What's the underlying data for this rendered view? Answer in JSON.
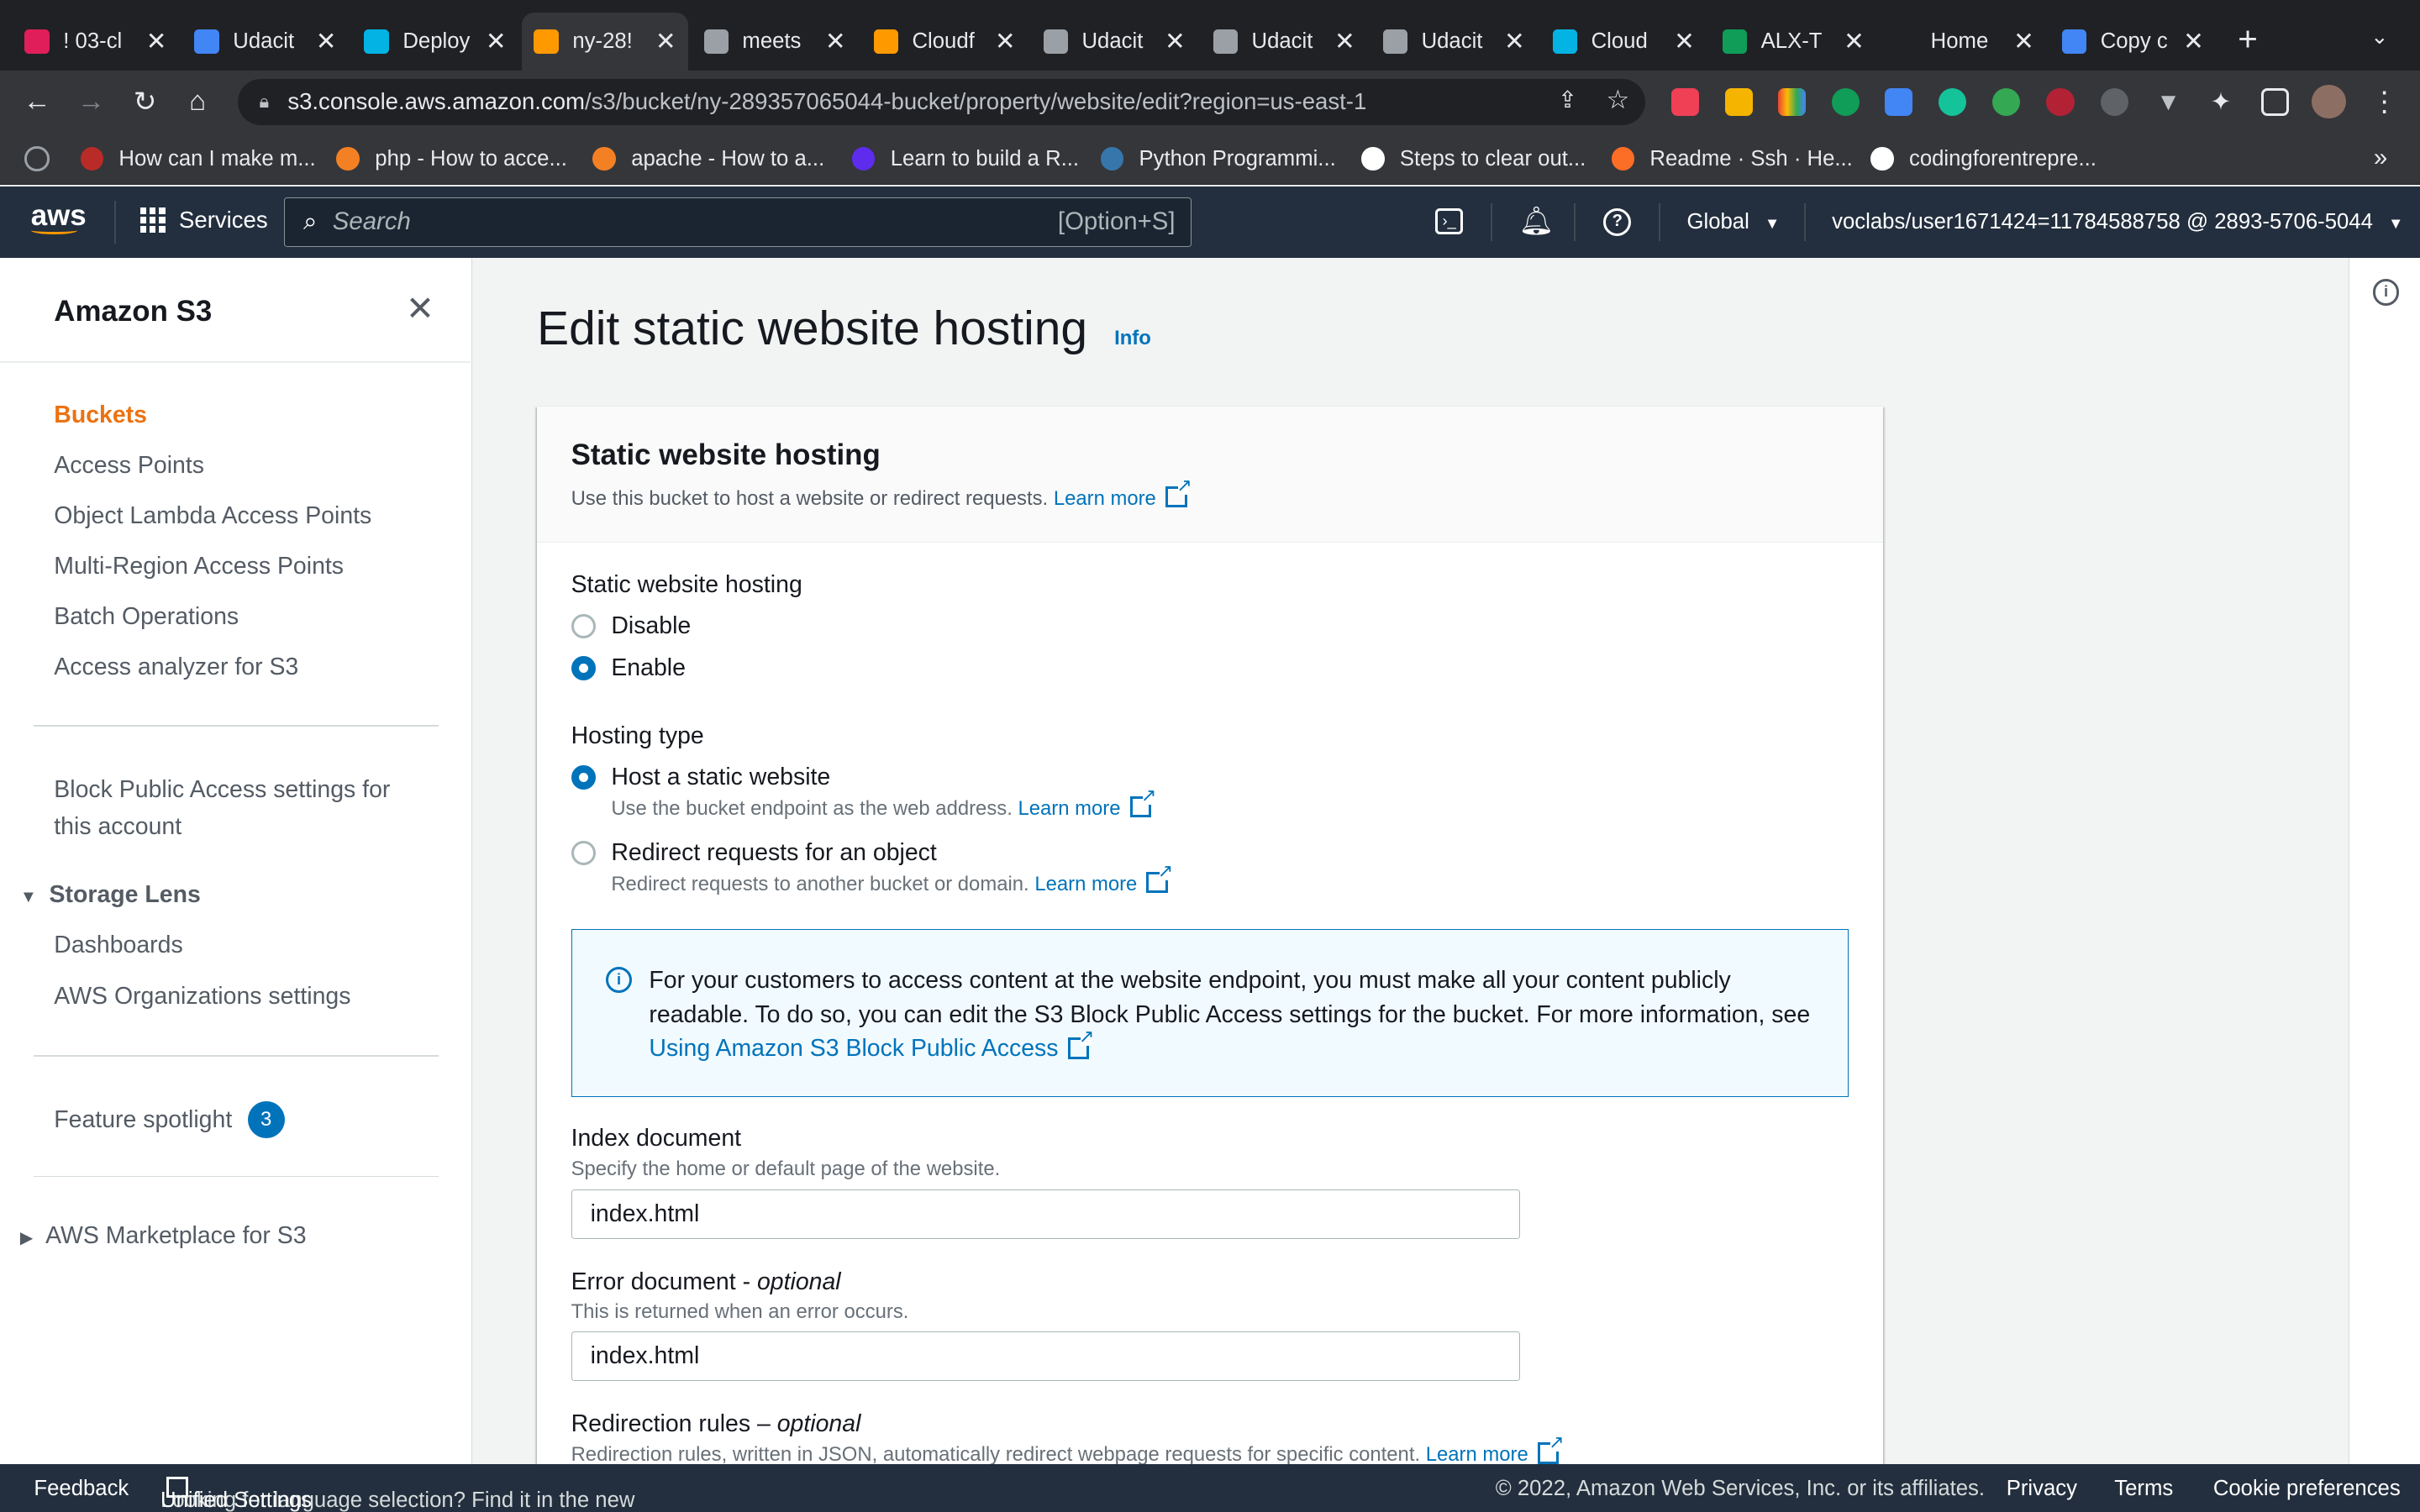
{
  "browser": {
    "tabs": [
      {
        "title": "! 03-cl",
        "favicon_color": "#e01e5a",
        "active": false
      },
      {
        "title": "Udacit",
        "favicon_color": "#4285f4",
        "active": false
      },
      {
        "title": "Deploy",
        "favicon_color": "#02b3e4",
        "active": false
      },
      {
        "title": "ny-28!",
        "favicon_color": "#f90",
        "active": true
      },
      {
        "title": "meets",
        "favicon_color": "#9aa0a6",
        "active": false
      },
      {
        "title": "Cloudf",
        "favicon_color": "#f90",
        "active": false
      },
      {
        "title": "Udacit",
        "favicon_color": "#9aa0a6",
        "active": false
      },
      {
        "title": "Udacit",
        "favicon_color": "#9aa0a6",
        "active": false
      },
      {
        "title": "Udacit",
        "favicon_color": "#9aa0a6",
        "active": false
      },
      {
        "title": "Cloud",
        "favicon_color": "#02b3e4",
        "active": false
      },
      {
        "title": "ALX-T",
        "favicon_color": "#0f9d58",
        "active": false
      },
      {
        "title": "Home",
        "favicon_color": "#202124",
        "active": false
      },
      {
        "title": "Copy c",
        "favicon_color": "#4285f4",
        "active": false
      }
    ],
    "url_host": "s3.console.aws.amazon.com",
    "url_path": "/s3/bucket/ny-289357065044-bucket/property/website/edit?region=us-east-1",
    "bookmarks": [
      {
        "label": "How can I make m...",
        "color": "#b92b27"
      },
      {
        "label": "php - How to acce...",
        "color": "#f48024"
      },
      {
        "label": "apache - How to a...",
        "color": "#f48024"
      },
      {
        "label": "Learn to build a R...",
        "color": "#5e2ced"
      },
      {
        "label": "Python Programmi...",
        "color": "#3776ab"
      },
      {
        "label": "Steps to clear out...",
        "color": "#ffffff"
      },
      {
        "label": "Readme · Ssh · He...",
        "color": "#fc6d26"
      },
      {
        "label": "codingforentrepre...",
        "color": "#ffffff"
      }
    ]
  },
  "aws_header": {
    "logo": "aws",
    "services_label": "Services",
    "search_placeholder": "Search",
    "search_shortcut": "[Option+S]",
    "region": "Global",
    "account": "voclabs/user1671424=11784588758 @ 2893-5706-5044"
  },
  "sidebar": {
    "title": "Amazon S3",
    "items": [
      "Buckets",
      "Access Points",
      "Object Lambda Access Points",
      "Multi-Region Access Points",
      "Batch Operations",
      "Access analyzer for S3"
    ],
    "block_public_line1": "Block Public Access settings for",
    "block_public_line2": "this account",
    "storage_lens_header": "Storage Lens",
    "storage_lens_items": [
      "Dashboards",
      "AWS Organizations settings"
    ],
    "feature_spotlight": "Feature spotlight",
    "feature_spotlight_count": "3",
    "marketplace": "AWS Marketplace for S3"
  },
  "page": {
    "title": "Edit static website hosting",
    "info_link": "Info",
    "panel_title": "Static website hosting",
    "panel_desc": "Use this bucket to host a website or redirect requests.",
    "learn_more": "Learn more",
    "hosting_label": "Static website hosting",
    "opt_disable": "Disable",
    "opt_enable": "Enable",
    "hosting_type_label": "Hosting type",
    "opt_host_static": "Host a static website",
    "opt_host_static_desc": "Use the bucket endpoint as the web address.",
    "opt_redirect": "Redirect requests for an object",
    "opt_redirect_desc": "Redirect requests to another bucket or domain.",
    "alert_line1": "For your customers to access content at the website endpoint, you must make all your content publicly",
    "alert_line2": "readable. To do so, you can edit the S3 Block Public Access settings for the bucket. For more information, see",
    "alert_link": "Using Amazon S3 Block Public Access",
    "index_label": "Index document",
    "index_desc": "Specify the home or default page of the website.",
    "index_value": "index.html",
    "error_label": "Error document -",
    "optional": "optional",
    "error_desc": "This is returned when an error occurs.",
    "error_value": "index.html",
    "redirection_label": "Redirection rules –",
    "redirection_desc": "Redirection rules, written in JSON, automatically redirect webpage requests for specific content."
  },
  "footer": {
    "feedback": "Feedback",
    "lang_text": "Looking for language selection? Find it in the new",
    "unified": "Unified Settings",
    "copyright": "© 2022, Amazon Web Services, Inc. or its affiliates.",
    "privacy": "Privacy",
    "terms": "Terms",
    "cookies": "Cookie preferences"
  }
}
